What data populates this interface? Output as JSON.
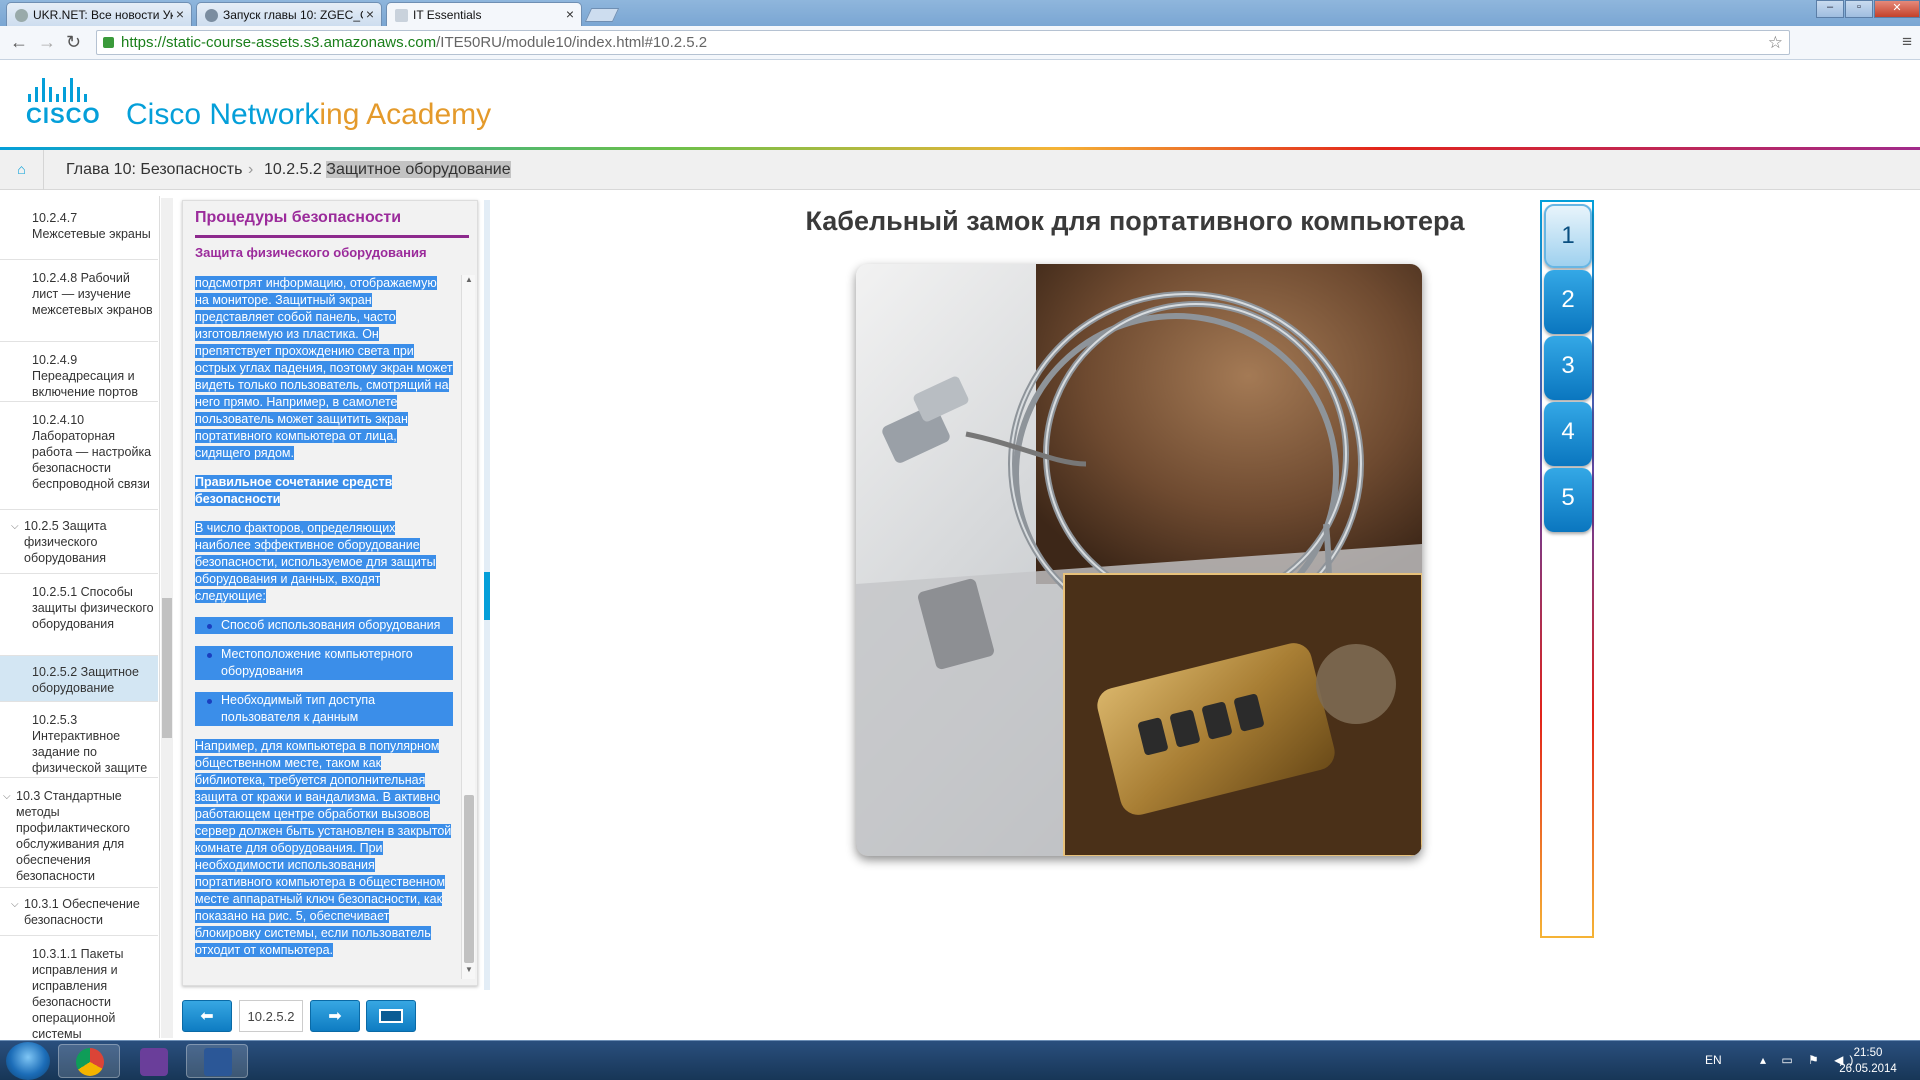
{
  "browser": {
    "tabs": [
      {
        "title": "UKR.NET: Все новости Ук",
        "active": false
      },
      {
        "title": "Запуск главы 10: ZGEC_G",
        "active": false
      },
      {
        "title": "IT Essentials",
        "active": true
      }
    ],
    "url_scheme": "https://",
    "url_host": "static-course-assets.s3.amazonaws.com",
    "url_path": "/ITE50RU/module10/index.html#10.2.5.2"
  },
  "header": {
    "logo_text": "CISCO",
    "title_part1": "Cisco Network",
    "title_part2": "ing",
    "title_part3": " Academy"
  },
  "breadcrumb": {
    "chapter": "Глава 10: Безопасность",
    "separator": "›",
    "page_prefix": "10.2.5.2 ",
    "page_title": "Защитное оборудование"
  },
  "toc": {
    "items": [
      {
        "label": "10.2.4.7 Межсетевые экраны"
      },
      {
        "label": "10.2.4.8 Рабочий лист — изучение межсетевых экранов"
      },
      {
        "label": "10.2.4.9 Переадресация и включение портов"
      },
      {
        "label": "10.2.4.10 Лабораторная работа — настройка безопасности беспроводной связи"
      },
      {
        "label": "10.2.5 Защита физического оборудования"
      },
      {
        "label": "10.2.5.1 Способы защиты физического оборудования"
      },
      {
        "label": "10.2.5.2 Защитное оборудование"
      },
      {
        "label": "10.2.5.3 Интерактивное задание по физической защите"
      },
      {
        "label": "10.3 Стандартные методы профилактического обслуживания для обеспечения безопасности"
      },
      {
        "label": "10.3.1 Обеспечение безопасности"
      },
      {
        "label": "10.3.1.1 Пакеты исправления и исправления безопасности операционной системы"
      }
    ]
  },
  "text_panel": {
    "title": "Процедуры безопасности",
    "subtitle": "Защита физического оборудования",
    "para1": "подсмотрят информацию, отображаемую на мониторе. Защитный экран представляет собой панель, часто изготовляемую из пластика. Он препятствует прохождению света при острых углах падения, поэтому экран может видеть только пользователь, смотрящий на него прямо. Например, в самолете пользователь может защитить экран портативного компьютера от лица, сидящего рядом.",
    "heading2": "Правильное сочетание средств безопасности",
    "para2": "В число факторов, определяющих наиболее эффективное оборудование безопасности, используемое для защиты оборудования и данных, входят следующие:",
    "bullets": [
      "Способ использования оборудования",
      "Местоположение компьютерного оборудования",
      "Необходимый тип доступа пользователя к данным"
    ],
    "para3": "Например, для компьютера в популярном общественном месте, таком как библиотека, требуется дополнительная защита от кражи и вандализма. В активно работающем центре обработки вызовов сервер должен быть установлен в закрытой комнате для оборудования. При необходимости использования портативного компьютера в общественном месте аппаратный ключ безопасности, как показано на рис. 5, обеспечивает блокировку системы, если пользователь отходит от компьютера."
  },
  "nav": {
    "page_number": "10.2.5.2"
  },
  "figure": {
    "title": "Кабельный замок для портативного компьютера",
    "tabs": [
      "1",
      "2",
      "3",
      "4",
      "5"
    ],
    "active_tab": "1"
  },
  "taskbar": {
    "lang": "EN",
    "time": "21:50",
    "date": "26.05.2014"
  },
  "colors": {
    "cisco_blue": "#049fd9",
    "purple_heading": "#9b2b9b",
    "selection": "#3b8ee9"
  }
}
